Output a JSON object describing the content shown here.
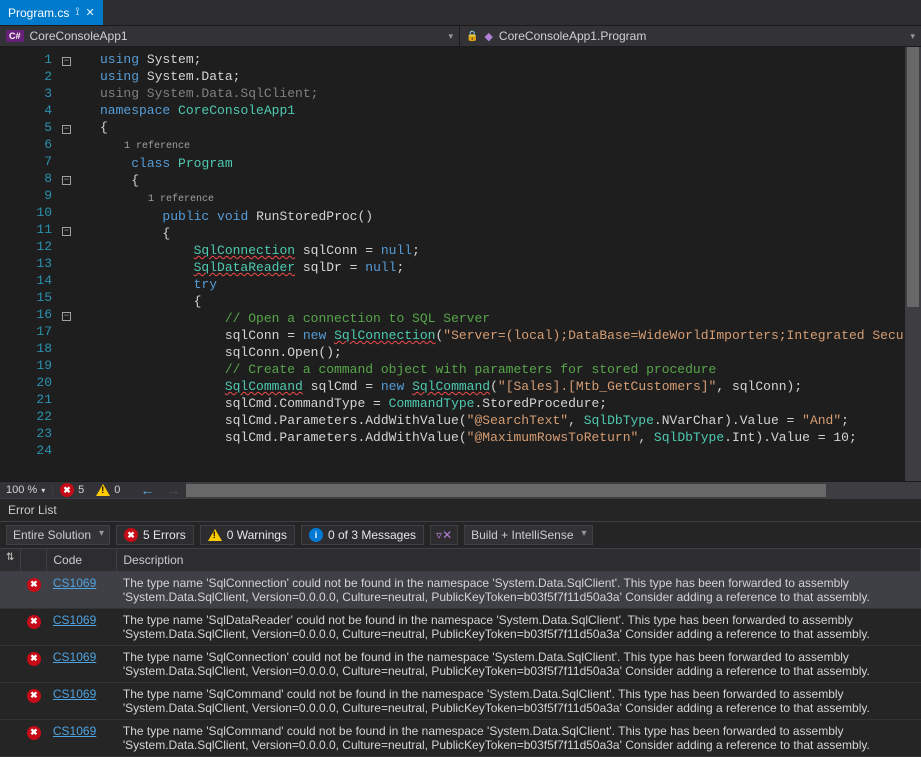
{
  "tab": {
    "filename": "Program.cs"
  },
  "navbar": {
    "leftLabel": "CoreConsoleApp1",
    "rightLabel": "CoreConsoleApp1.Program"
  },
  "statusbar": {
    "zoom": "100 %",
    "errorCount": "5",
    "warnCount": "0"
  },
  "codeLines": [
    {
      "n": 1,
      "fold": "−",
      "seg": [
        {
          "c": "kw",
          "t": "using"
        },
        {
          "t": " System;"
        }
      ]
    },
    {
      "n": 2,
      "seg": [
        {
          "c": "kw",
          "t": "using"
        },
        {
          "t": " System.Data;"
        }
      ]
    },
    {
      "n": 3,
      "seg": [
        {
          "c": "dim",
          "t": "using System.Data.SqlClient;"
        }
      ]
    },
    {
      "n": 4,
      "seg": [
        {
          "t": ""
        }
      ]
    },
    {
      "n": 5,
      "fold": "−",
      "seg": [
        {
          "c": "kw",
          "t": "namespace"
        },
        {
          "t": " "
        },
        {
          "c": "type",
          "t": "CoreConsoleApp1"
        }
      ]
    },
    {
      "n": 6,
      "seg": [
        {
          "t": "{"
        }
      ]
    },
    {
      "n": "",
      "seg": [
        {
          "c": "ref",
          "t": "    1 reference"
        }
      ]
    },
    {
      "n": 7,
      "fold": "−",
      "seg": [
        {
          "t": "    "
        },
        {
          "c": "kw",
          "t": "class"
        },
        {
          "t": " "
        },
        {
          "c": "type",
          "t": "Program"
        }
      ]
    },
    {
      "n": 8,
      "seg": [
        {
          "t": "    {"
        }
      ]
    },
    {
      "n": "",
      "seg": [
        {
          "c": "ref",
          "t": "        1 reference"
        }
      ]
    },
    {
      "n": 9,
      "fold": "−",
      "seg": [
        {
          "t": "        "
        },
        {
          "c": "kw",
          "t": "public"
        },
        {
          "t": " "
        },
        {
          "c": "kw",
          "t": "void"
        },
        {
          "t": " RunStoredProc()"
        }
      ]
    },
    {
      "n": 10,
      "seg": [
        {
          "t": "        {"
        }
      ]
    },
    {
      "n": 11,
      "seg": [
        {
          "t": "            "
        },
        {
          "c": "type wavy",
          "t": "SqlConnection"
        },
        {
          "t": " sqlConn = "
        },
        {
          "c": "kw",
          "t": "null"
        },
        {
          "t": ";"
        }
      ]
    },
    {
      "n": 12,
      "seg": [
        {
          "t": "            "
        },
        {
          "c": "type wavy",
          "t": "SqlDataReader"
        },
        {
          "t": " sqlDr = "
        },
        {
          "c": "kw",
          "t": "null"
        },
        {
          "t": ";"
        }
      ]
    },
    {
      "n": 13,
      "seg": [
        {
          "t": ""
        }
      ]
    },
    {
      "n": 14,
      "fold": "−",
      "seg": [
        {
          "t": "            "
        },
        {
          "c": "kw",
          "t": "try"
        }
      ]
    },
    {
      "n": 15,
      "seg": [
        {
          "t": "            {"
        }
      ]
    },
    {
      "n": 16,
      "seg": [
        {
          "t": "                "
        },
        {
          "c": "com",
          "t": "// Open a connection to SQL Server"
        }
      ]
    },
    {
      "n": 17,
      "seg": [
        {
          "t": "                sqlConn = "
        },
        {
          "c": "kw",
          "t": "new"
        },
        {
          "t": " "
        },
        {
          "c": "type wavy",
          "t": "SqlConnection"
        },
        {
          "t": "("
        },
        {
          "c": "str",
          "t": "\"Server=(local);DataBase=WideWorldImporters;Integrated Security=SSPI\""
        },
        {
          "t": ");"
        }
      ]
    },
    {
      "n": 18,
      "seg": [
        {
          "t": "                sqlConn.Open();"
        }
      ]
    },
    {
      "n": 19,
      "seg": [
        {
          "t": ""
        }
      ]
    },
    {
      "n": 20,
      "seg": [
        {
          "t": "                "
        },
        {
          "c": "com",
          "t": "// Create a command object with parameters for stored procedure"
        }
      ]
    },
    {
      "n": 21,
      "seg": [
        {
          "t": "                "
        },
        {
          "c": "type wavy",
          "t": "SqlCommand"
        },
        {
          "t": " sqlCmd = "
        },
        {
          "c": "kw",
          "t": "new"
        },
        {
          "t": " "
        },
        {
          "c": "type wavy",
          "t": "SqlCommand"
        },
        {
          "t": "("
        },
        {
          "c": "str",
          "t": "\"[Sales].[Mtb_GetCustomers]\""
        },
        {
          "t": ", sqlConn);"
        }
      ]
    },
    {
      "n": 22,
      "seg": [
        {
          "t": "                sqlCmd.CommandType = "
        },
        {
          "c": "type",
          "t": "CommandType"
        },
        {
          "t": ".StoredProcedure;"
        }
      ]
    },
    {
      "n": 23,
      "seg": [
        {
          "t": "                sqlCmd.Parameters.AddWithValue("
        },
        {
          "c": "str",
          "t": "\"@SearchText\""
        },
        {
          "t": ", "
        },
        {
          "c": "type",
          "t": "SqlDbType"
        },
        {
          "t": ".NVarChar).Value = "
        },
        {
          "c": "str",
          "t": "\"And\""
        },
        {
          "t": ";"
        }
      ]
    },
    {
      "n": 24,
      "seg": [
        {
          "t": "                sqlCmd.Parameters.AddWithValue("
        },
        {
          "c": "str",
          "t": "\"@MaximumRowsToReturn\""
        },
        {
          "t": ", "
        },
        {
          "c": "type",
          "t": "SqlDbType"
        },
        {
          "t": ".Int).Value = 10;"
        }
      ]
    }
  ],
  "errorListTitle": "Error List",
  "toolbar": {
    "scope": "Entire Solution",
    "errors": "5 Errors",
    "warnings": "0 Warnings",
    "messages": "0 of 3 Messages",
    "filter": "Build + IntelliSense"
  },
  "columns": {
    "code": "Code",
    "description": "Description"
  },
  "errors": [
    {
      "code": "CS1069",
      "sel": true,
      "desc": "The type name 'SqlConnection' could not be found in the namespace 'System.Data.SqlClient'. This type has been forwarded to assembly 'System.Data.SqlClient, Version=0.0.0.0, Culture=neutral, PublicKeyToken=b03f5f7f11d50a3a' Consider adding a reference to that assembly."
    },
    {
      "code": "CS1069",
      "desc": "The type name 'SqlDataReader' could not be found in the namespace 'System.Data.SqlClient'. This type has been forwarded to assembly 'System.Data.SqlClient, Version=0.0.0.0, Culture=neutral, PublicKeyToken=b03f5f7f11d50a3a' Consider adding a reference to that assembly."
    },
    {
      "code": "CS1069",
      "desc": "The type name 'SqlConnection' could not be found in the namespace 'System.Data.SqlClient'. This type has been forwarded to assembly 'System.Data.SqlClient, Version=0.0.0.0, Culture=neutral, PublicKeyToken=b03f5f7f11d50a3a' Consider adding a reference to that assembly."
    },
    {
      "code": "CS1069",
      "desc": "The type name 'SqlCommand' could not be found in the namespace 'System.Data.SqlClient'. This type has been forwarded to assembly 'System.Data.SqlClient, Version=0.0.0.0, Culture=neutral, PublicKeyToken=b03f5f7f11d50a3a' Consider adding a reference to that assembly."
    },
    {
      "code": "CS1069",
      "desc": "The type name 'SqlCommand' could not be found in the namespace 'System.Data.SqlClient'. This type has been forwarded to assembly 'System.Data.SqlClient, Version=0.0.0.0, Culture=neutral, PublicKeyToken=b03f5f7f11d50a3a' Consider adding a reference to that assembly."
    }
  ]
}
